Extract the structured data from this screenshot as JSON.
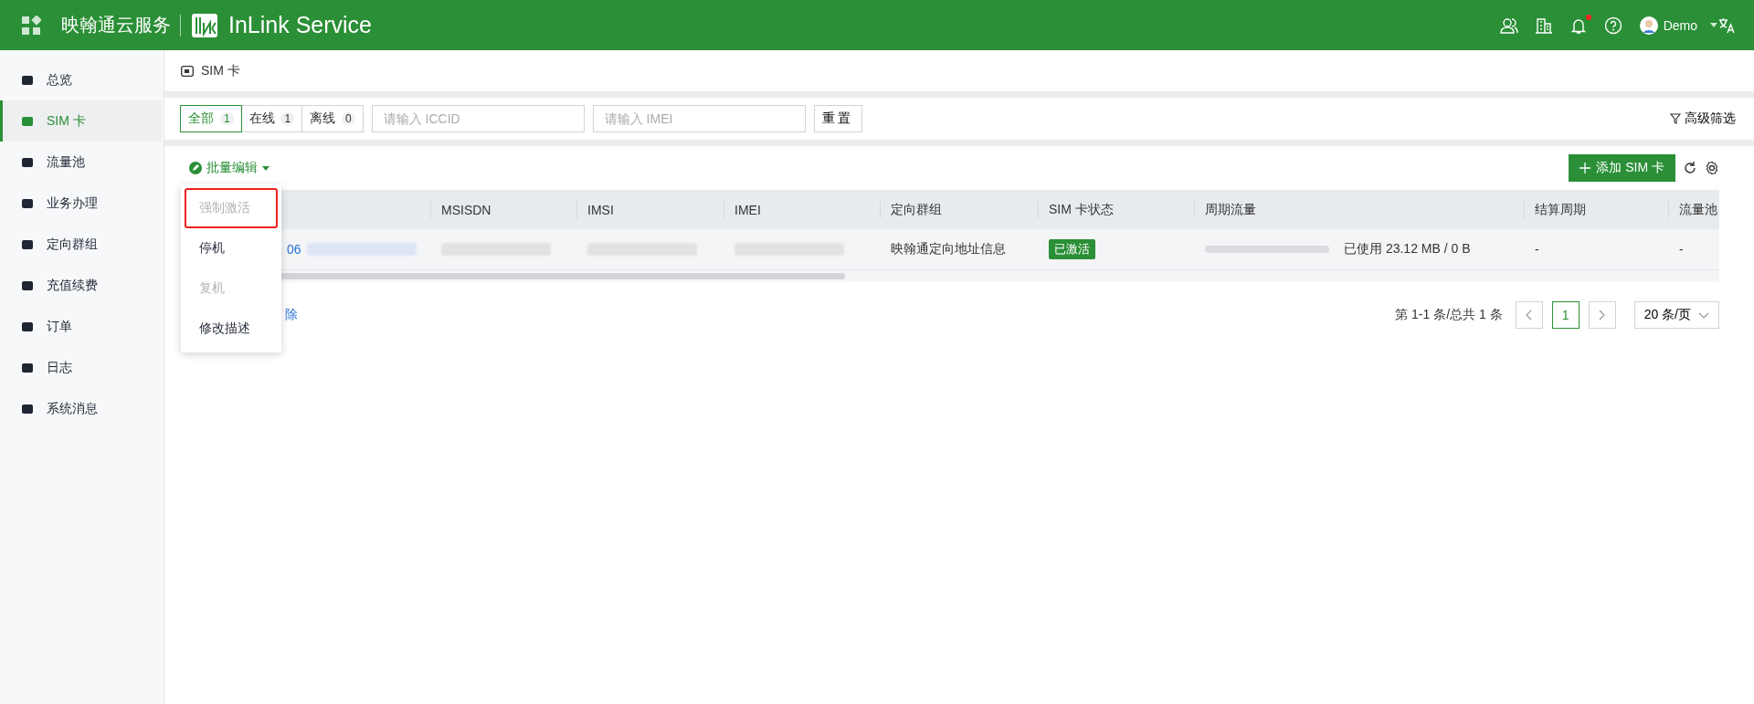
{
  "header": {
    "title": "映翰通云服务",
    "brand": "InLink Service",
    "user": "Demo",
    "notification_dot": true
  },
  "sidebar": {
    "items": [
      {
        "label": "总览",
        "selected": false
      },
      {
        "label": "SIM 卡",
        "selected": true
      },
      {
        "label": "流量池",
        "selected": false
      },
      {
        "label": "业务办理",
        "selected": false
      },
      {
        "label": "定向群组",
        "selected": false
      },
      {
        "label": "充值续费",
        "selected": false
      },
      {
        "label": "订单",
        "selected": false
      },
      {
        "label": "日志",
        "selected": false
      },
      {
        "label": "系统消息",
        "selected": false
      }
    ]
  },
  "breadcrumb": "SIM 卡",
  "filters": {
    "tabs": [
      {
        "label": "全部",
        "count": "1",
        "selected": true
      },
      {
        "label": "在线",
        "count": "1",
        "selected": false
      },
      {
        "label": "离线",
        "count": "0",
        "selected": false
      }
    ],
    "inputs": [
      {
        "placeholder": "请输入 ICCID"
      },
      {
        "placeholder": "请输入 IMEI"
      }
    ],
    "reset": "重置",
    "advanced": "高级筛选"
  },
  "toolbar": {
    "batch_edit": "批量编辑",
    "add": "添加 SIM 卡"
  },
  "batch_menu": [
    {
      "label": "强制激活",
      "disabled": true,
      "highlighted": true
    },
    {
      "label": "停机",
      "disabled": false,
      "highlighted": false
    },
    {
      "label": "复机",
      "disabled": true,
      "highlighted": false
    },
    {
      "label": "修改描述",
      "disabled": false,
      "highlighted": false
    }
  ],
  "table": {
    "columns": [
      "",
      "MSISDN",
      "IMSI",
      "IMEI",
      "定向群组",
      "SIM 卡状态",
      "周期流量",
      "结算周期",
      "流量池"
    ],
    "rows": [
      {
        "cells": [
          {
            "kind": "link",
            "text": "06"
          },
          {
            "kind": "redacted"
          },
          {
            "kind": "redacted"
          },
          {
            "kind": "redacted"
          },
          {
            "kind": "text",
            "text": "映翰通定向地址信息"
          },
          {
            "kind": "tag",
            "text": "已激活"
          },
          {
            "kind": "usage",
            "level": 0,
            "text": "已使用 23.12 MB / 0 B"
          },
          {
            "kind": "text",
            "text": "-"
          },
          {
            "kind": "text",
            "text": "-"
          }
        ]
      }
    ]
  },
  "delete_link": "除",
  "pagination": {
    "summary": "第 1-1 条/总共 1 条",
    "pages": [
      {
        "label": "1",
        "selected": true
      }
    ],
    "page_size": "20 条/页"
  }
}
